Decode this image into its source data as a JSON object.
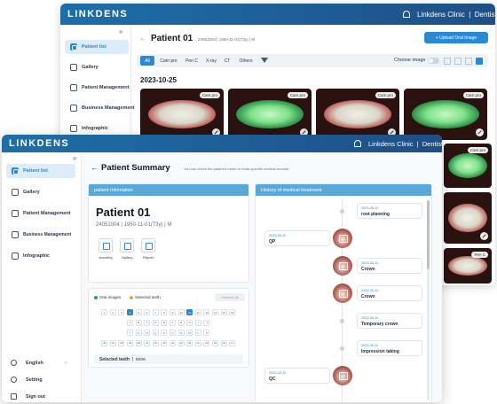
{
  "brand": "LINKDENS",
  "clinic": "Linkdens Clinic",
  "role": "Dentist",
  "collapse_icon": "«",
  "nav": [
    "Patient list",
    "Gallery",
    "Patient Management",
    "Business Management",
    "Infographic"
  ],
  "back_window": {
    "patient_name": "Patient 01",
    "patient_id": "24051004",
    "dob_age": "1950-11-01(73y)",
    "sex": "M",
    "upload_label": "+ Upload Oral Image",
    "tabs": [
      "All",
      "Cam pro",
      "Pen C",
      "X-ray",
      "CT",
      "Others"
    ],
    "active_tab": "All",
    "choose_image_label": "Choose image",
    "date": "2023-10-25",
    "thumb_chips": [
      "Cam pro",
      "Cam pro",
      "Cam pro",
      "Cam pro"
    ],
    "right_column_chips": [
      "Cam pro",
      "Pen C"
    ]
  },
  "front_window": {
    "page_title": "Patient Summary",
    "page_subtitle": "You can check the patient's entire or tooth-specific medical records.",
    "info_panel_title": "patient Infomation",
    "patient_name": "Patient 01",
    "patient_meta": "24051004  |  1950-11-01(73y)  |  M",
    "actions": [
      "shooting",
      "Gallery",
      "Report"
    ],
    "legend": [
      "Oral images",
      "Selected teeth"
    ],
    "legend_colors": {
      "oral_images": "#2a89d4",
      "selected_teeth": "#e8a838"
    },
    "unselect_all_label": "Unselect All",
    "teeth_rows": [
      [
        "1",
        "2",
        "3",
        "4",
        "5",
        "6",
        "7",
        "8",
        "9",
        "10",
        "11",
        "12",
        "13",
        "14",
        "15",
        "16"
      ],
      [
        "A",
        "B",
        "C",
        "D",
        "E",
        "F",
        "G",
        "H",
        "I",
        "J"
      ],
      [
        "T",
        "S",
        "R",
        "Q",
        "P",
        "O",
        "N",
        "M",
        "L",
        "K"
      ],
      [
        "32",
        "31",
        "30",
        "29",
        "28",
        "27",
        "26",
        "25",
        "24",
        "23",
        "22",
        "21",
        "20",
        "19",
        "18",
        "17"
      ]
    ],
    "selected_teeth_numbers": [
      "4",
      "11"
    ],
    "selected_teeth_label": "Selected teeth",
    "selected_teeth_value": "none",
    "history_panel_title": "History of medical treatment",
    "history": [
      {
        "date": "2023-05-12",
        "procedure": "root planning",
        "side": "right"
      },
      {
        "date": "2023-05-12",
        "procedure": "QP",
        "side": "left"
      },
      {
        "date": "2023-05-12",
        "procedure": "Crown",
        "side": "right"
      },
      {
        "date": "2023-05-12",
        "procedure": "Crown",
        "side": "right"
      },
      {
        "date": "2023-05-12",
        "procedure": "Temporary crown",
        "side": "right"
      },
      {
        "date": "2023-05-12",
        "procedure": "Impression taking",
        "side": "right"
      },
      {
        "date": "2023-05-12",
        "procedure": "QC",
        "side": "left"
      }
    ],
    "language": "English",
    "setting_label": "Setting",
    "signout_label": "Sign out"
  }
}
